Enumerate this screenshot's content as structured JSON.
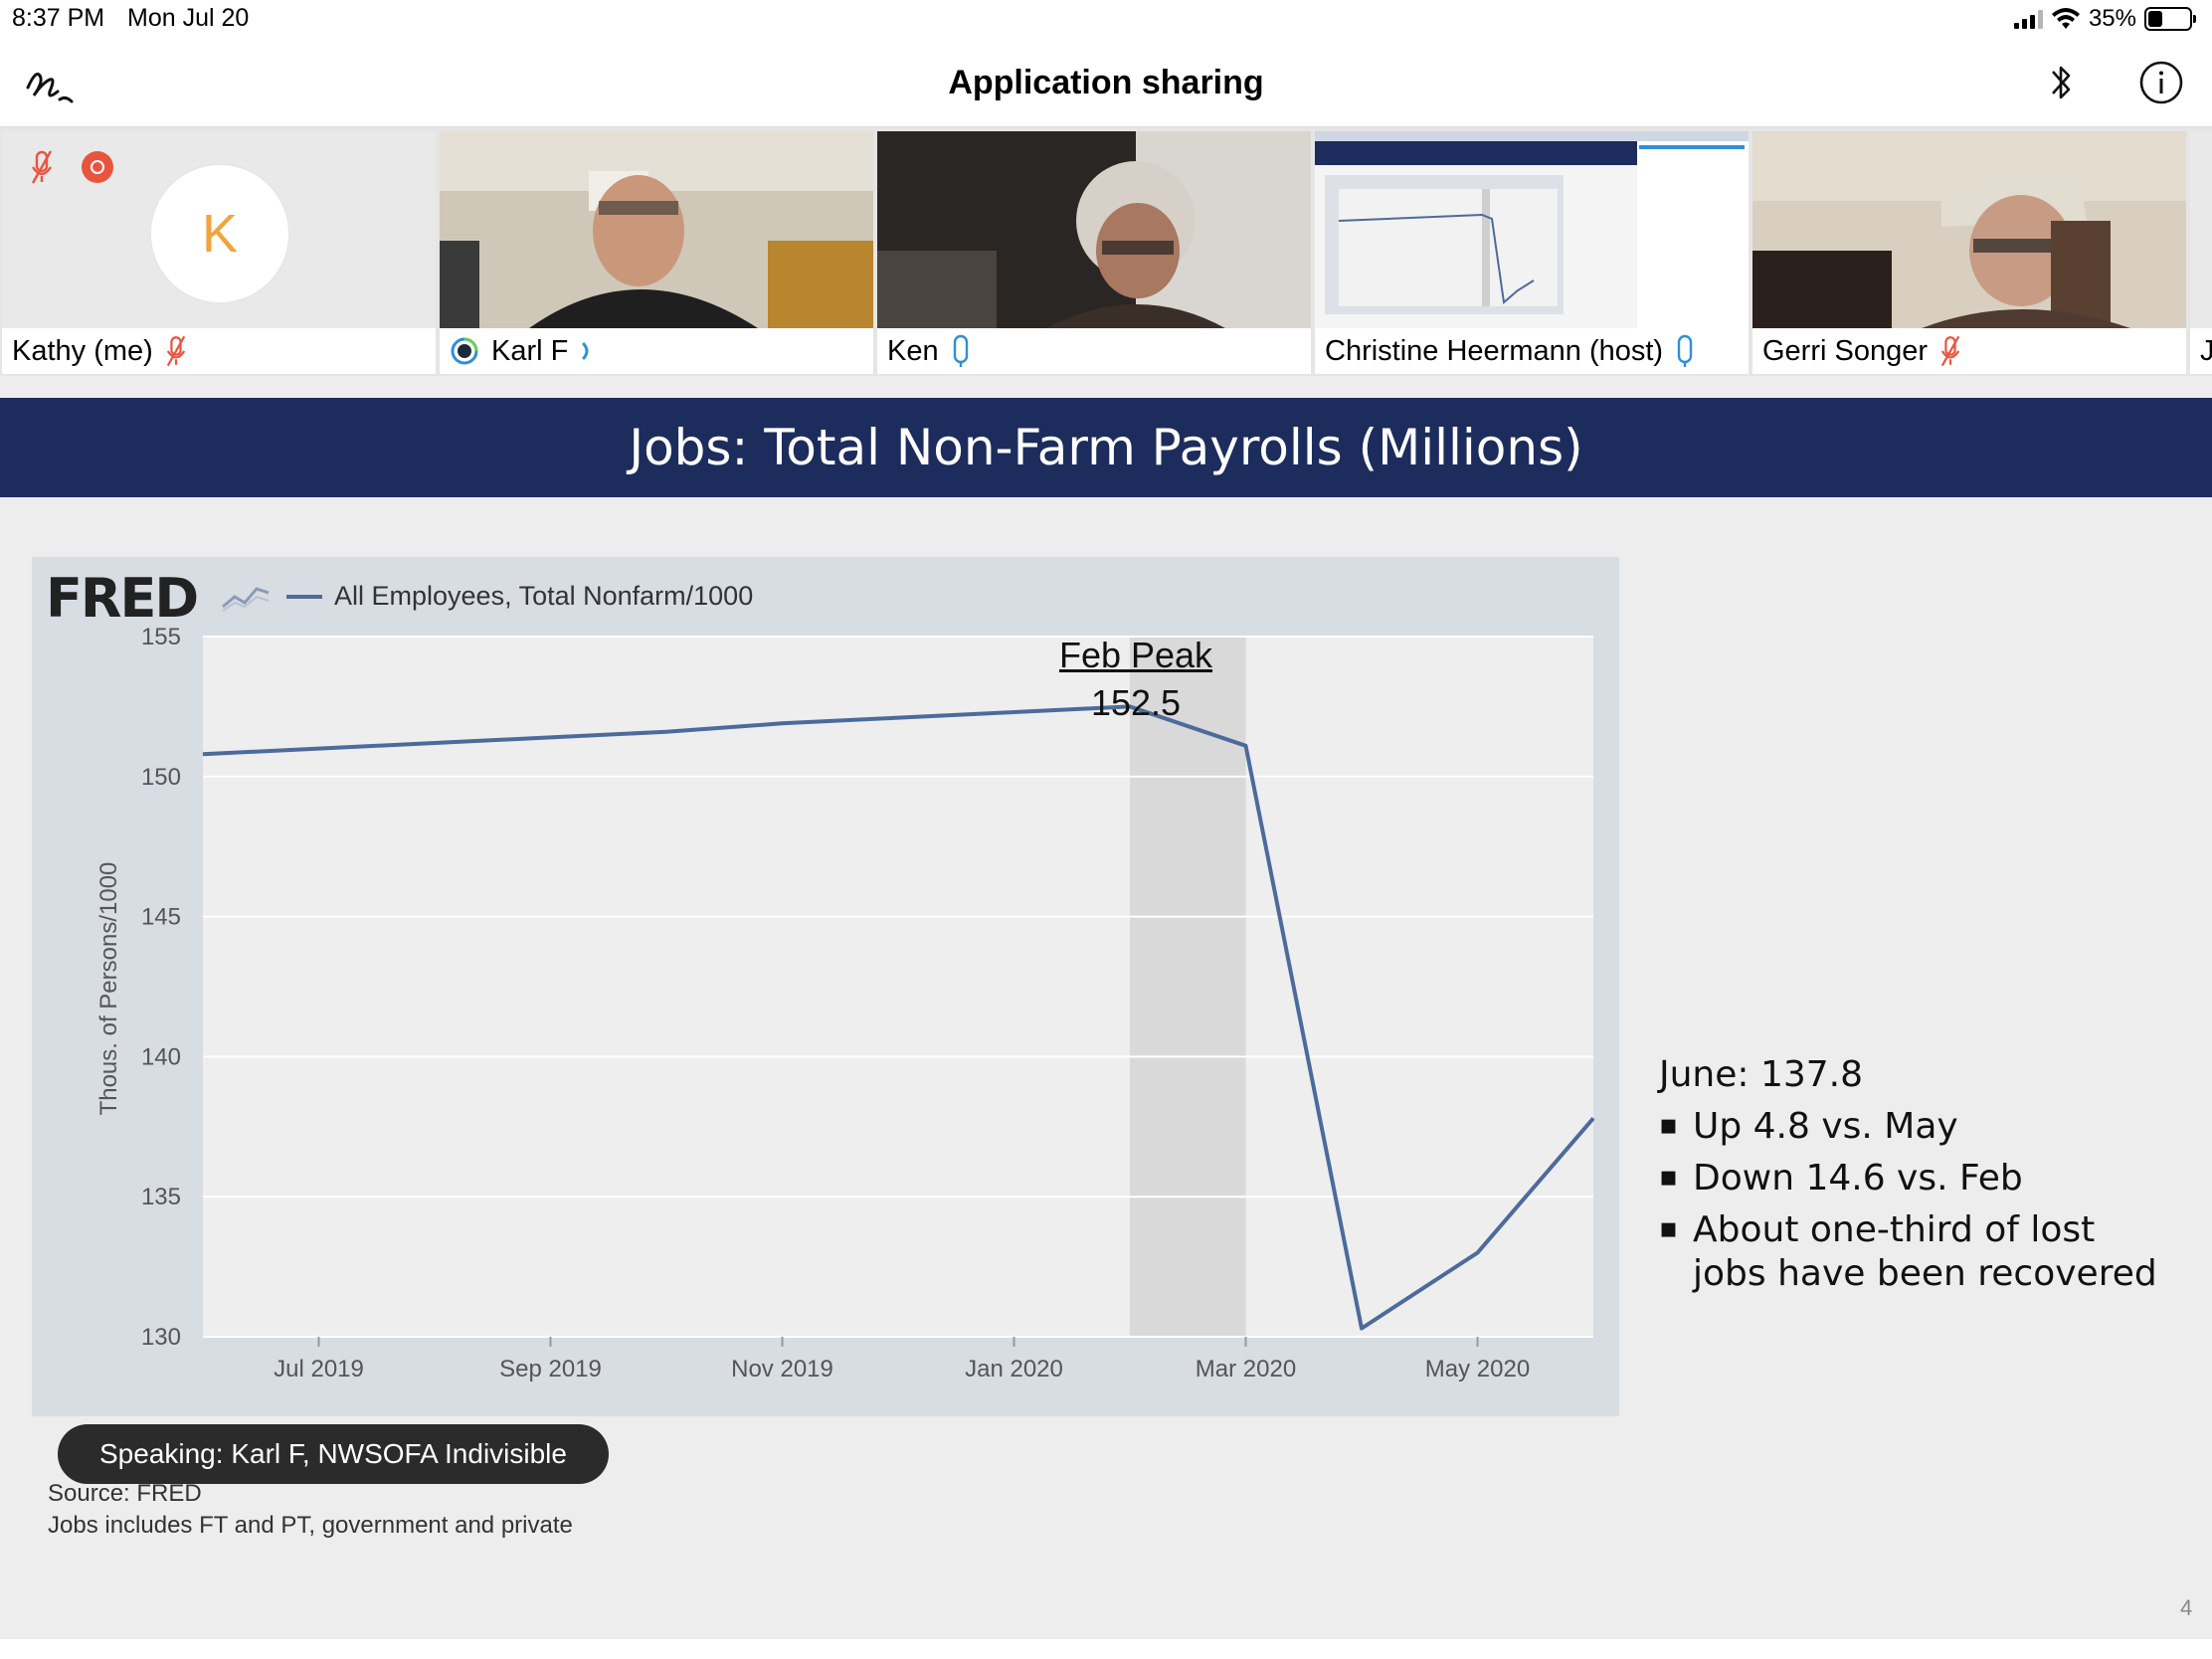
{
  "status": {
    "time": "8:37 PM",
    "date": "Mon Jul 20",
    "battery": "35%",
    "battery_level": 0.35
  },
  "nav": {
    "title": "Application sharing"
  },
  "participants": [
    {
      "name": "Kathy (me)",
      "initial": "K"
    },
    {
      "name": "Karl F"
    },
    {
      "name": "Ken"
    },
    {
      "name": "Christine Heermann (host)"
    },
    {
      "name": "Gerri Songer"
    },
    {
      "name": "J"
    }
  ],
  "slide": {
    "title": "Jobs:  Total Non-Farm Payrolls (Millions)",
    "fred_logo": "FRED",
    "notes_head": "June: 137.8",
    "notes": [
      {
        "line1": "Up 4.8 vs. May"
      },
      {
        "line1": "Down 14.6 vs. Feb"
      },
      {
        "line1": "About one-third of lost",
        "line2": "jobs have been recovered"
      }
    ],
    "source_line1": "Source:  FRED",
    "source_line2": "Jobs includes FT and PT, government and private",
    "page_number": "4"
  },
  "speaking_banner": "Speaking: Karl F, NWSOFA Indivisible",
  "colors": {
    "header_navy": "#1c2c5c",
    "series_line": "#4c6b9b",
    "avatar_orange": "#f0a43a",
    "record_red": "#e8553f",
    "mic_blue": "#2f8fd8"
  },
  "chart_data": {
    "type": "line",
    "legend": "All Employees, Total Nonfarm/1000",
    "ylabel": "Thous. of Persons/1000",
    "ylim": [
      130,
      155
    ],
    "yticks": [
      155,
      150,
      145,
      140,
      135,
      130
    ],
    "xtick_labels": [
      "Jul 2019",
      "Sep 2019",
      "Nov 2019",
      "Jan 2020",
      "Mar 2020",
      "May 2020"
    ],
    "x": [
      "2019-06",
      "2019-07",
      "2019-08",
      "2019-09",
      "2019-10",
      "2019-11",
      "2019-12",
      "2020-01",
      "2020-02",
      "2020-03",
      "2020-04",
      "2020-05",
      "2020-06"
    ],
    "series": [
      {
        "values": [
          150.8,
          151.0,
          151.2,
          151.4,
          151.6,
          151.9,
          152.1,
          152.3,
          152.5,
          151.1,
          130.3,
          133.0,
          137.8
        ]
      }
    ],
    "recession_shading": [
      "2020-02",
      "2020-03"
    ],
    "annotation": {
      "title": "Feb Peak",
      "value": "152.5"
    },
    "grid": true
  }
}
